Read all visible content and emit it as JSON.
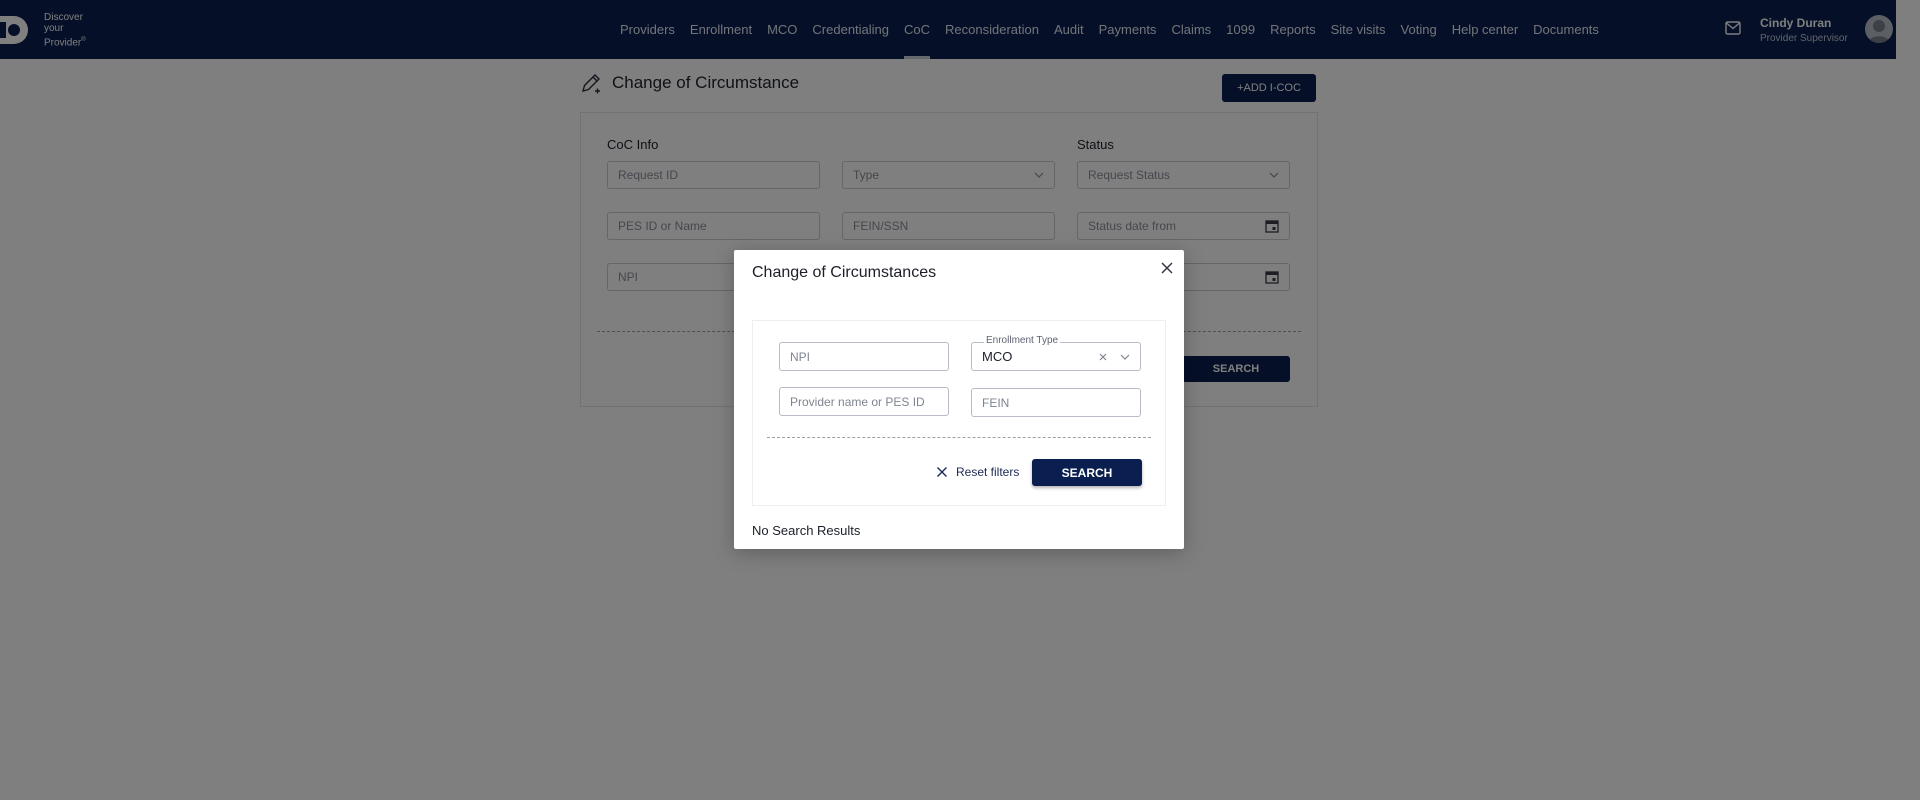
{
  "header": {
    "logo_text": [
      "Discover",
      "your",
      "Provider"
    ],
    "logo_mark": "®",
    "nav": [
      "Providers",
      "Enrollment",
      "MCO",
      "Credentialing",
      "CoC",
      "Reconsideration",
      "Audit",
      "Payments",
      "Claims",
      "1099",
      "Reports",
      "Site visits",
      "Voting",
      "Help center",
      "Documents"
    ],
    "active_nav": "CoC",
    "user_name": "Cindy Duran",
    "user_role": "Provider Supervisor"
  },
  "page": {
    "title": "Change of Circumstance",
    "add_button": "+ADD I-COC",
    "coc_info_label": "CoC Info",
    "status_label": "Status",
    "fields": {
      "request_id": "Request ID",
      "type": "Type",
      "request_status": "Request Status",
      "pes_id": "PES ID or Name",
      "fein_ssn": "FEIN/SSN",
      "status_date_from": "Status date from",
      "npi": "NPI"
    },
    "search_button": "SEARCH"
  },
  "modal": {
    "title": "Change of Circumstances",
    "npi_placeholder": "NPI",
    "enrollment_type_label": "Enrollment Type",
    "enrollment_type_value": "MCO",
    "provider_placeholder": "Provider name or PES ID",
    "fein_placeholder": "FEIN",
    "reset_label": "Reset filters",
    "search_label": "SEARCH",
    "no_results": "No Search Results"
  },
  "colors": {
    "brand": "#0a1f4f"
  }
}
